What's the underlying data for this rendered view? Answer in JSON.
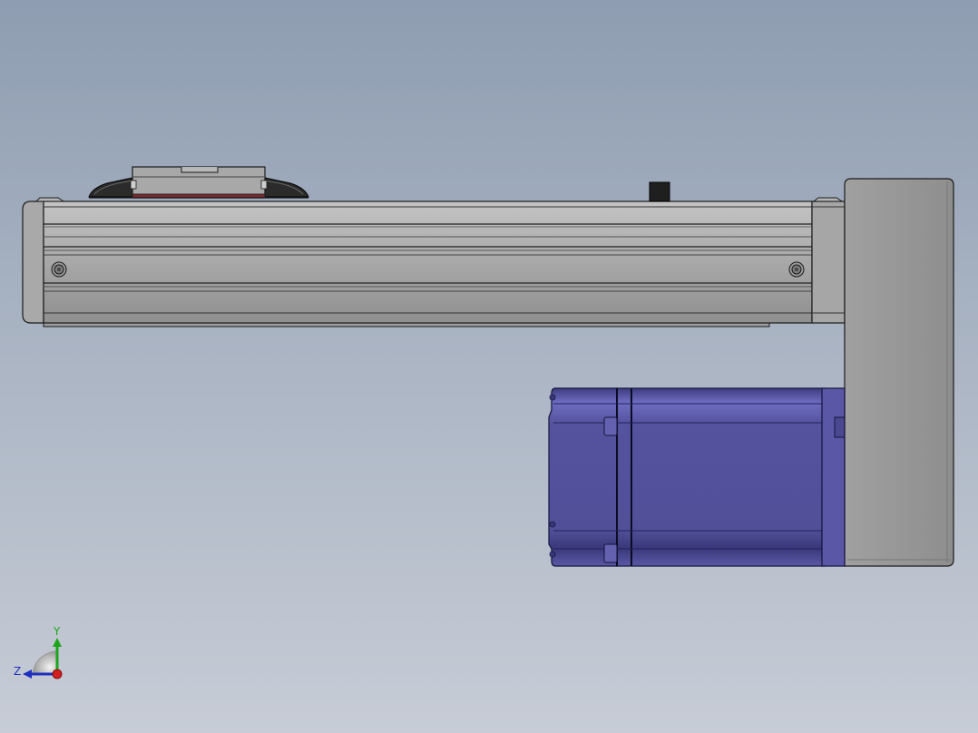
{
  "viewport": {
    "background_top": "#8e9db1",
    "background_bottom": "#c7ccd6"
  },
  "model": {
    "rail_color": "#a3a3a3",
    "rail_edge_color": "#1a1a1a",
    "motor_color": "#53519a",
    "motor_highlight_color": "#6b69b8",
    "plate_color": "#9a9a9a",
    "carriage_cap_color": "#2b2b2b"
  },
  "triad": {
    "y_axis_label": "Y",
    "z_axis_label": "Z",
    "y_axis_color": "#1ea51e",
    "z_axis_color": "#1f2fbf",
    "x_axis_color": "#d01f1f"
  }
}
